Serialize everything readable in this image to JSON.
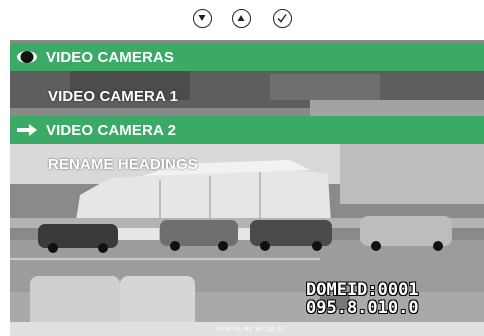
{
  "toolbar": {
    "buttons": [
      {
        "name": "down-arrow-button",
        "icon": "triangle-down-icon"
      },
      {
        "name": "up-arrow-button",
        "icon": "triangle-up-icon"
      },
      {
        "name": "confirm-button",
        "icon": "check-icon"
      }
    ]
  },
  "menu": {
    "header_label": "VIDEO CAMERAS",
    "header_icon": "eye-icon",
    "items": [
      {
        "label": "VIDEO CAMERA 1",
        "selected": false
      },
      {
        "label": "VIDEO CAMERA 2",
        "selected": true,
        "icon": "arrow-right-icon"
      },
      {
        "label": "RENAME HEADINGS",
        "selected": false
      }
    ]
  },
  "camera_overlay": {
    "dome_id": "DOMEID:0001",
    "coords": "095.8.010.0",
    "timestamp": "2010-01-01 00:18:57"
  },
  "colors": {
    "accent_green": "#3aaa66"
  }
}
